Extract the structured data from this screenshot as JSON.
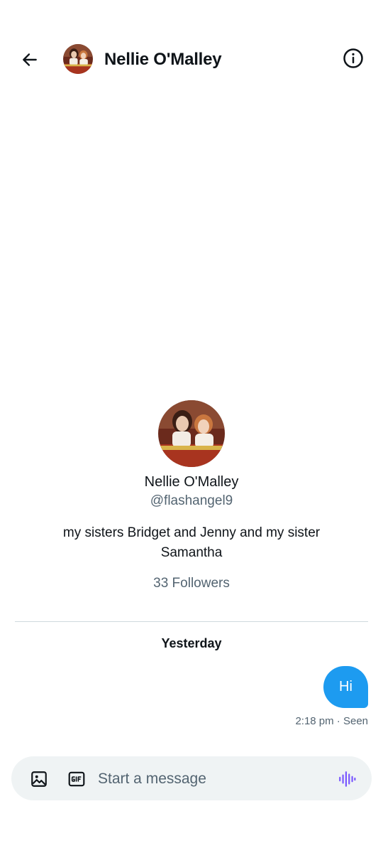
{
  "header": {
    "back_icon": "arrow-left-icon",
    "name": "Nellie O'Malley",
    "info_icon": "info-circle-icon"
  },
  "profile": {
    "name": "Nellie O'Malley",
    "handle": "@flashangel9",
    "bio": "my sisters Bridget and Jenny and my sister Samantha",
    "followers": "33 Followers"
  },
  "conversation": {
    "day_label": "Yesterday",
    "messages": [
      {
        "text": "Hi",
        "meta": "2:18 pm · Seen"
      }
    ]
  },
  "composer": {
    "placeholder": "Start a message",
    "image_icon": "image-icon",
    "gif_icon": "gif-icon",
    "voice_icon": "voice-waveform-icon"
  },
  "colors": {
    "accent": "#1d9bf0",
    "voice": "#7856ff",
    "secondary_text": "#536471",
    "composer_bg": "#eff3f4"
  }
}
